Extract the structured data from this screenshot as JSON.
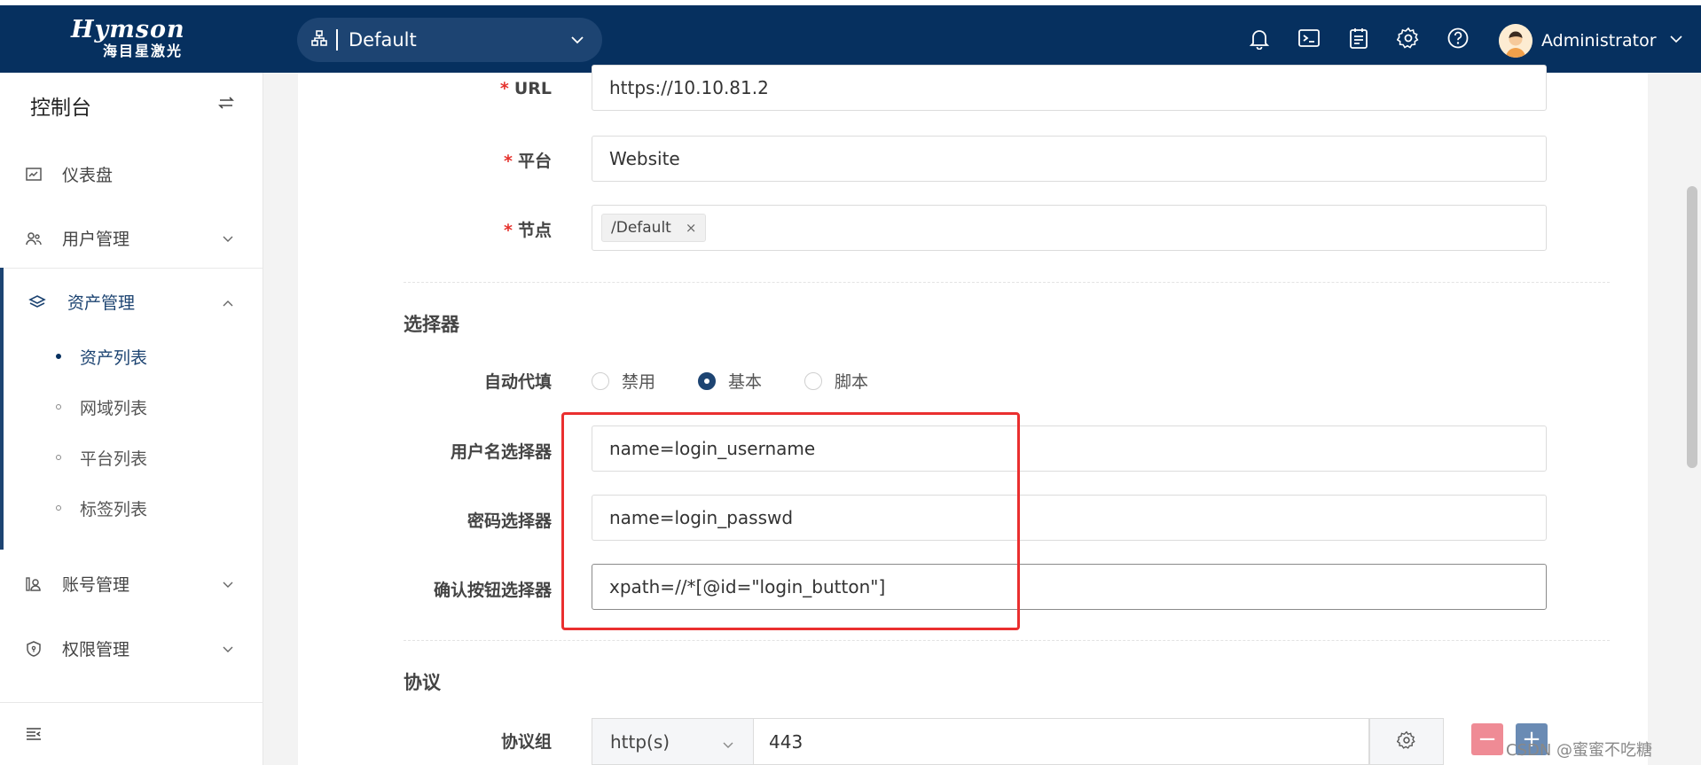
{
  "header": {
    "logo_main": "Hymson",
    "logo_sub": "海目星激光",
    "org_label": "Default",
    "user_name": "Administrator"
  },
  "sidebar": {
    "title": "控制台",
    "items": [
      {
        "label": "仪表盘",
        "icon": "dashboard-icon"
      },
      {
        "label": "用户管理",
        "icon": "users-icon"
      },
      {
        "label": "资产管理",
        "icon": "layers-icon"
      },
      {
        "label": "账号管理",
        "icon": "account-icon"
      },
      {
        "label": "权限管理",
        "icon": "shield-icon"
      }
    ],
    "sub_items": [
      {
        "label": "资产列表",
        "active": true
      },
      {
        "label": "网域列表",
        "active": false
      },
      {
        "label": "平台列表",
        "active": false
      },
      {
        "label": "标签列表",
        "active": false
      }
    ]
  },
  "form": {
    "url": {
      "label": "URL",
      "value": "https://10.10.81.2"
    },
    "platform": {
      "label": "平台",
      "value": "Website"
    },
    "node": {
      "label": "节点",
      "tag": "/Default",
      "tag_remove": "×"
    },
    "selector_section": "选择器",
    "autofill": {
      "label": "自动代填",
      "options": [
        "禁用",
        "基本",
        "脚本"
      ],
      "selected": "基本"
    },
    "username_selector": {
      "label": "用户名选择器",
      "value": "name=login_username"
    },
    "password_selector": {
      "label": "密码选择器",
      "value": "name=login_passwd"
    },
    "submit_selector": {
      "label": "确认按钮选择器",
      "value": "xpath=//*[@id=\"login_button\"]"
    },
    "protocol_section": "协议",
    "protocol_group": {
      "label": "协议组",
      "protocol": "http(s)",
      "port": "443",
      "remove": "−",
      "add": "+"
    }
  },
  "required_mark": "*",
  "watermark": "CSDN @蜜蜜不吃糖",
  "colors": {
    "header_bg": "#06305f",
    "accent": "#1d4472",
    "required": "#e5322d",
    "highlight_box": "#ea2f2f"
  }
}
